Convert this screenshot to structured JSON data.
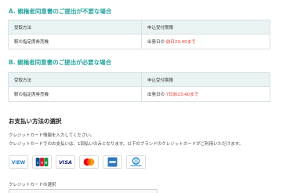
{
  "section_a": {
    "heading": "A. 親権者同意書のご提出が不要な場合",
    "table": {
      "headers": [
        "受取方法",
        "申込受付期限"
      ],
      "row": {
        "method": "駅の指定席券売機",
        "deadline_prefix": "出発日の",
        "deadline_highlight": "前日23:40まで"
      }
    }
  },
  "section_b": {
    "heading": "B. 親権者同意書のご提出が必要な場合",
    "table": {
      "headers": [
        "受取方法",
        "申込受付期限"
      ],
      "row": {
        "method": "駅の指定席券売機",
        "deadline_prefix": "出発日の",
        "deadline_highlight": "7日前23:40まで"
      }
    }
  },
  "payment": {
    "heading": "お支払い方法の選択",
    "line1": "クレジットカード情報を入力してください。",
    "line2": "クレジットカードでのお支払いは、1回払いのみとなります。以下のブランドのクレジットカードがご利用いただけます。",
    "brands": [
      {
        "name": "VIEW",
        "icon": "view-card-icon"
      },
      {
        "name": "JCB",
        "icon": "jcb-card-icon"
      },
      {
        "name": "VISA",
        "icon": "visa-card-icon"
      },
      {
        "name": "Mastercard",
        "icon": "mastercard-card-icon"
      },
      {
        "name": "American Express",
        "icon": "amex-card-icon"
      },
      {
        "name": "Diners Club",
        "icon": "diners-card-icon"
      }
    ],
    "select_label": "クレジットカードの選択"
  },
  "colors": {
    "accent": "#2ba6a0",
    "highlight": "#e0332c",
    "table_header_bg": "#eaf3f3"
  }
}
